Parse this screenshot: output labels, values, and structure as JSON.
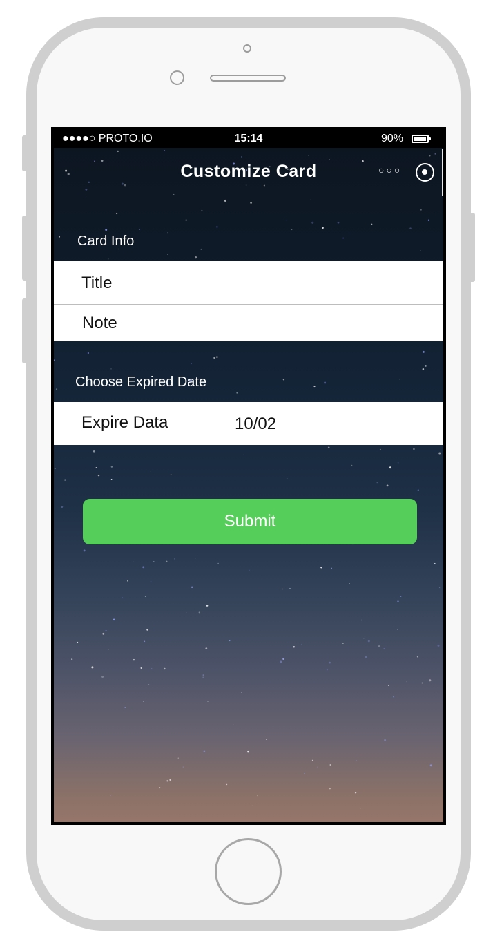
{
  "status_bar": {
    "carrier": "●●●●○ PROTO.IO",
    "time": "15:14",
    "battery": "90%"
  },
  "nav": {
    "title": "Customize Card",
    "more_icon": "more-dots-icon",
    "action_icon": "target-circle-icon"
  },
  "card_info": {
    "section_label": "Card Info",
    "title_field": "Title",
    "note_field": "Note"
  },
  "expire": {
    "section_label": "Choose Expired Date",
    "field_label": "Expire Data",
    "field_value": "10/02"
  },
  "submit": {
    "label": "Submit",
    "color": "#56cf5a"
  }
}
